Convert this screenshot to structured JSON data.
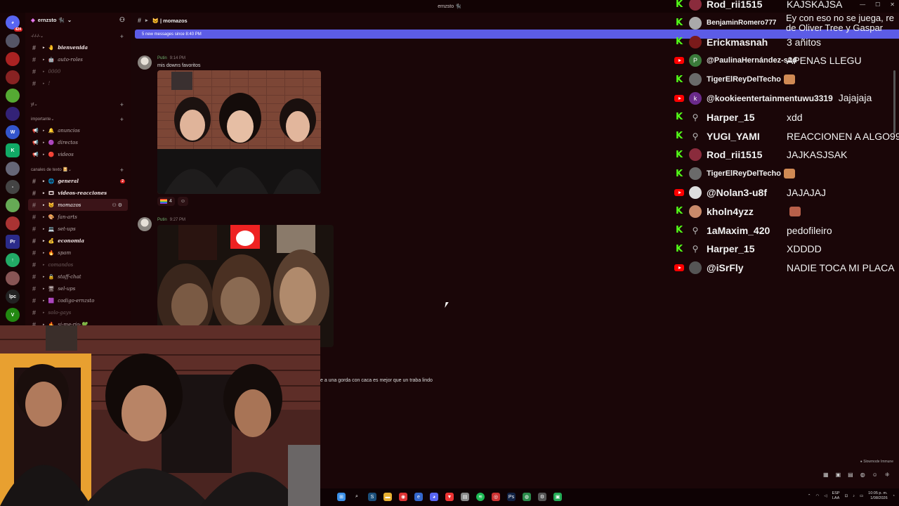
{
  "window": {
    "title": "ernzsto 🐈‍⬛"
  },
  "server": {
    "name": "ernzsto 🐈‍⬛",
    "rail_badge": "424"
  },
  "sidebar": {
    "categories": [
      {
        "name": "-/-/-/-",
        "channels": [
          {
            "icon": "🤚",
            "name": "bienvenida",
            "state": "unread"
          },
          {
            "icon": "🤖",
            "name": "auto-roles",
            "state": "normal"
          },
          {
            "icon": "",
            "name": "0000",
            "state": "muted"
          },
          {
            "icon": "",
            "name": "!",
            "state": "muted"
          }
        ]
      },
      {
        "name": "yt",
        "channels": []
      },
      {
        "name": "importante",
        "channels": [
          {
            "icon": "🔔",
            "name": "anuncios",
            "state": "normal"
          },
          {
            "icon": "🟣",
            "name": "directos",
            "state": "normal"
          },
          {
            "icon": "🔴",
            "name": "videos",
            "state": "normal"
          }
        ]
      },
      {
        "name": "canales de texto 📔",
        "channels": [
          {
            "icon": "🌐",
            "name": "general",
            "state": "unread",
            "badge": "2"
          },
          {
            "icon": "🎞",
            "name": "videos-reacciones",
            "state": "unread"
          },
          {
            "icon": "😺",
            "name": "momazos",
            "state": "active"
          },
          {
            "icon": "🎨",
            "name": "fan-arts",
            "state": "normal"
          },
          {
            "icon": "💻",
            "name": "set-ups",
            "state": "normal"
          },
          {
            "icon": "💰",
            "name": "economia",
            "state": "unread"
          },
          {
            "icon": "🔥",
            "name": "spam",
            "state": "normal"
          },
          {
            "icon": "",
            "name": "comandos",
            "state": "muted"
          },
          {
            "icon": "🔒",
            "name": "staff-chat",
            "state": "normal"
          },
          {
            "icon": "🖥",
            "name": "sel-ups",
            "state": "normal"
          },
          {
            "icon": "🟪",
            "name": "codigo-ernzsto",
            "state": "normal"
          },
          {
            "icon": "",
            "name": "solo-gays",
            "state": "muted"
          },
          {
            "icon": "🔥",
            "name": "si-me-rio-💚",
            "state": "normal"
          }
        ]
      }
    ]
  },
  "channel_header": {
    "name": "😺 | momazos"
  },
  "new_messages_bar": "5 new messages since 8:40 PM",
  "messages": [
    {
      "author": "Putin",
      "time": "9:14 PM",
      "text": "mis downs favoritos",
      "reactions": [
        {
          "emoji": "🏳️‍🌈",
          "count": "4"
        }
      ]
    },
    {
      "author": "Putin",
      "time": "9:27 PM",
      "text": ""
    }
  ],
  "partial_message_text": "e a una gorda con caca es mejor que un traba lindo",
  "slowmode_text": "Slowmode Immune",
  "taskbar": {
    "lang": "ESP",
    "lang_sub": "LAA",
    "clock_time": "10:05 p. m.",
    "clock_date": "1/08/2026"
  },
  "stream_chat": [
    {
      "platform": "kick",
      "user": "Rod_rii1515",
      "message": "KAJSKAJSA",
      "avatar_color": "#8a2b3c"
    },
    {
      "platform": "kick",
      "user": "BenjaminRomero777",
      "message": "Ey con eso no se juega, re",
      "message2": "de Oliver Tree y Gaspar",
      "avatar_color": "#aaa"
    },
    {
      "platform": "kick",
      "user": "Erickmasnah",
      "message": "3 añitos",
      "avatar_color": "#7a1a1a"
    },
    {
      "platform": "youtube",
      "user": "@PaulinaHernández-s2d",
      "message": "APENAS LLEGU",
      "avatar_color": "#3a7a3a",
      "avatar_letter": "P"
    },
    {
      "platform": "kick",
      "user": "TigerElReyDelTecho",
      "message": "",
      "emote": true,
      "avatar_color": "#6a6a6a"
    },
    {
      "platform": "youtube",
      "user": "@kookieentertainmentuwu3319",
      "message": "Jajajaja",
      "avatar_color": "#6a2a8a",
      "avatar_letter": "k"
    },
    {
      "platform": "kick",
      "user": "Harper_15",
      "message": "xdd",
      "avatar_color": ""
    },
    {
      "platform": "kick",
      "user": "YUGI_YAMI",
      "message": "REACCIONEN A ALGO99",
      "avatar_color": ""
    },
    {
      "platform": "kick",
      "user": "Rod_rii1515",
      "message": "JAJKASJSAK",
      "avatar_color": "#8a2b3c"
    },
    {
      "platform": "kick",
      "user": "TigerElReyDelTecho",
      "message": "",
      "emote": true,
      "avatar_color": "#6a6a6a"
    },
    {
      "platform": "youtube",
      "user": "@Nolan3-u8f",
      "message": "JAJAJAJ",
      "avatar_color": "#ddd"
    },
    {
      "platform": "kick",
      "user": "kholn4yzz",
      "message": "",
      "emote": true,
      "avatar_color": "#c98a6a"
    },
    {
      "platform": "kick",
      "user": "1aMaxim_420",
      "message": "pedofileiro",
      "avatar_color": ""
    },
    {
      "platform": "kick",
      "user": "Harper_15",
      "message": "XDDDD",
      "avatar_color": ""
    },
    {
      "platform": "youtube",
      "user": "@iSrFly",
      "message": "NADIE TOCA MI PLACA",
      "avatar_color": "#555"
    }
  ]
}
